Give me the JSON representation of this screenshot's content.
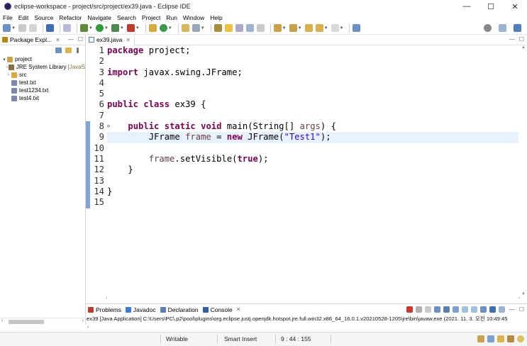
{
  "window": {
    "title": "eclipse-workspace - project/src/project/ex39.java - Eclipse IDE",
    "controls": [
      "—",
      "☐",
      "✕"
    ]
  },
  "menu": [
    "File",
    "Edit",
    "Source",
    "Refactor",
    "Navigate",
    "Search",
    "Project",
    "Run",
    "Window",
    "Help"
  ],
  "package_explorer": {
    "tab_label": "Package Expl...",
    "tree": [
      {
        "label": "project",
        "level": 0,
        "arrow": "▾",
        "icon": "project-folder-icon",
        "color": "#c9a24a"
      },
      {
        "label": "JRE System Library",
        "suffix": "[JavaS",
        "level": 1,
        "arrow": "›",
        "icon": "library-icon",
        "color": "#8a6d3b"
      },
      {
        "label": "src",
        "level": 1,
        "arrow": "›",
        "icon": "source-folder-icon",
        "color": "#d9a93c"
      },
      {
        "label": "test.txt",
        "level": 1,
        "arrow": "",
        "icon": "text-file-icon",
        "color": "#7a8aa8"
      },
      {
        "label": "test1234.txt",
        "level": 1,
        "arrow": "",
        "icon": "text-file-icon",
        "color": "#7a8aa8"
      },
      {
        "label": "test4.txt",
        "level": 1,
        "arrow": "",
        "icon": "text-file-icon",
        "color": "#7a8aa8"
      }
    ]
  },
  "editor": {
    "tab_label": "ex39.java",
    "current_line": 9,
    "line_numbers": [
      "1",
      "2",
      "3",
      "4",
      "5",
      "6",
      "7",
      "8",
      "9",
      "10",
      "11",
      "12",
      "13",
      "14",
      "15"
    ],
    "code": [
      [
        {
          "t": "package",
          "c": "kw"
        },
        {
          "t": " project;",
          "c": ""
        }
      ],
      [],
      [
        {
          "t": "import",
          "c": "kw"
        },
        {
          "t": " javax.swing.JFrame;",
          "c": ""
        }
      ],
      [],
      [],
      [
        {
          "t": "public",
          "c": "kw"
        },
        {
          "t": " ",
          "c": ""
        },
        {
          "t": "class",
          "c": "kw"
        },
        {
          "t": " ex39 {",
          "c": ""
        }
      ],
      [],
      [
        {
          "t": "    ",
          "c": ""
        },
        {
          "t": "public",
          "c": "kw"
        },
        {
          "t": " ",
          "c": ""
        },
        {
          "t": "static",
          "c": "kw"
        },
        {
          "t": " ",
          "c": ""
        },
        {
          "t": "void",
          "c": "kw"
        },
        {
          "t": " main(String[] ",
          "c": ""
        },
        {
          "t": "args",
          "c": "loc"
        },
        {
          "t": ") {",
          "c": ""
        }
      ],
      [
        {
          "t": "        JFrame ",
          "c": ""
        },
        {
          "t": "frame",
          "c": "loc"
        },
        {
          "t": " = ",
          "c": ""
        },
        {
          "t": "new",
          "c": "kw"
        },
        {
          "t": " JFrame(",
          "c": ""
        },
        {
          "t": "\"Test1\"",
          "c": "str"
        },
        {
          "t": ");",
          "c": ""
        }
      ],
      [],
      [
        {
          "t": "        ",
          "c": ""
        },
        {
          "t": "frame",
          "c": "loc"
        },
        {
          "t": ".setVisible(",
          "c": ""
        },
        {
          "t": "true",
          "c": "kw"
        },
        {
          "t": ");",
          "c": ""
        }
      ],
      [
        {
          "t": "    }",
          "c": ""
        }
      ],
      [],
      [
        {
          "t": "}",
          "c": ""
        }
      ],
      []
    ]
  },
  "console": {
    "tabs": [
      {
        "label": "Problems",
        "icon": "problems-icon",
        "color": "#c0392b"
      },
      {
        "label": "Javadoc",
        "icon": "javadoc-icon",
        "color": "#3a7bd5"
      },
      {
        "label": "Declaration",
        "icon": "declaration-icon",
        "color": "#5b7fb9"
      },
      {
        "label": "Console",
        "icon": "console-icon",
        "color": "#2d5fa6"
      }
    ],
    "output_line": "ex39 [Java Application] C:\\Users\\PC\\.p2\\pool\\plugins\\org.eclipse.justj.openjdk.hotspot.jre.full.win32.x86_64_16.0.1.v20210528-1205\\jre\\bin\\javaw.exe  (2021. 11. 3. 오전 10:49:45"
  },
  "status": {
    "mode": "Writable",
    "insert": "Smart Insert",
    "position": "9 : 44 : 155"
  },
  "colors": {
    "keyword": "#7f0055",
    "string": "#2a00ff",
    "local_var": "#6a3e3e",
    "current_line_bg": "#e8f2fe",
    "change_ruler": "#7da6d8"
  }
}
